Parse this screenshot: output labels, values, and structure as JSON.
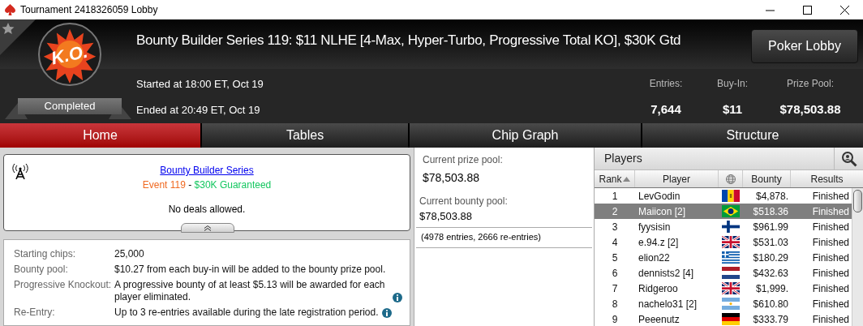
{
  "window": {
    "title": "Tournament 2418326059 Lobby"
  },
  "header": {
    "logo_text": "K.O.",
    "status": "Completed",
    "title": "Bounty Builder Series 119: $11 NLHE [4-Max, Hyper-Turbo, Progressive Total KO], $30K Gtd",
    "started": "Started at 18:00 ET, Oct 19",
    "ended": "Ended at 20:49 ET, Oct 19",
    "lobby_button": "Poker Lobby",
    "stats": [
      {
        "label": "Entries:",
        "value": "7,644"
      },
      {
        "label": "Buy-In:",
        "value": "$11"
      },
      {
        "label": "Prize Pool:",
        "value": "$78,503.88"
      }
    ]
  },
  "tabs": [
    {
      "label": "Home",
      "selected": true
    },
    {
      "label": "Tables",
      "selected": false
    },
    {
      "label": "Chip Graph",
      "selected": false
    },
    {
      "label": "Structure",
      "selected": false
    }
  ],
  "event_box": {
    "link": "Bounty Builder Series",
    "event": "Event 119",
    "separator": " - ",
    "guarantee": "$30K Guaranteed",
    "note": "No deals allowed."
  },
  "details": [
    {
      "label": "Starting chips:",
      "value": "25,000",
      "info": false
    },
    {
      "label": "Bounty pool:",
      "value": "$10.27 from each buy-in will be added to the bounty prize pool.",
      "info": false
    },
    {
      "label": "Progressive Knockout:",
      "value": "A progressive bounty of at least $5.13 will be awarded for each player eliminated.",
      "info": true
    },
    {
      "label": "Re-Entry:",
      "value": "Up to 3 re-entries available during the late registration period.",
      "info": true
    }
  ],
  "pools": {
    "prize_label": "Current prize pool:",
    "prize_value": "$78,503.88",
    "bounty_label": "Current bounty pool:",
    "bounty_value": "$78,503.88",
    "entries_note": "(4978 entries, 2666 re-entries)"
  },
  "players": {
    "title": "Players",
    "columns": [
      "Rank",
      "Player",
      "Bounty",
      "Results"
    ],
    "rows": [
      {
        "rank": "1",
        "player": "LevGodin",
        "kind": "md",
        "bounty": "$4,878.",
        "result": "Finished",
        "selected": false
      },
      {
        "rank": "2",
        "player": "Maiicon [2]",
        "kind": "br",
        "bounty": "$518.36",
        "result": "Finished",
        "selected": true
      },
      {
        "rank": "3",
        "player": "fyysisin",
        "kind": "fi",
        "bounty": "$961.99",
        "result": "Finished",
        "selected": false
      },
      {
        "rank": "4",
        "player": "e.94.z [2]",
        "kind": "gb",
        "bounty": "$531.03",
        "result": "Finished",
        "selected": false
      },
      {
        "rank": "5",
        "player": "elion22",
        "kind": "gr",
        "bounty": "$180.29",
        "result": "Finished",
        "selected": false
      },
      {
        "rank": "6",
        "player": "dennists2 [4]",
        "kind": "nl",
        "bounty": "$432.63",
        "result": "Finished",
        "selected": false
      },
      {
        "rank": "7",
        "player": "Ridgeroo",
        "kind": "gb",
        "bounty": "$1,999.",
        "result": "Finished",
        "selected": false
      },
      {
        "rank": "8",
        "player": "nachelo31 [2]",
        "kind": "ar",
        "bounty": "$610.80",
        "result": "Finished",
        "selected": false
      },
      {
        "rank": "9",
        "player": "Peeenutz",
        "kind": "de",
        "bounty": "$333.79",
        "result": "Finished",
        "selected": false
      }
    ]
  }
}
